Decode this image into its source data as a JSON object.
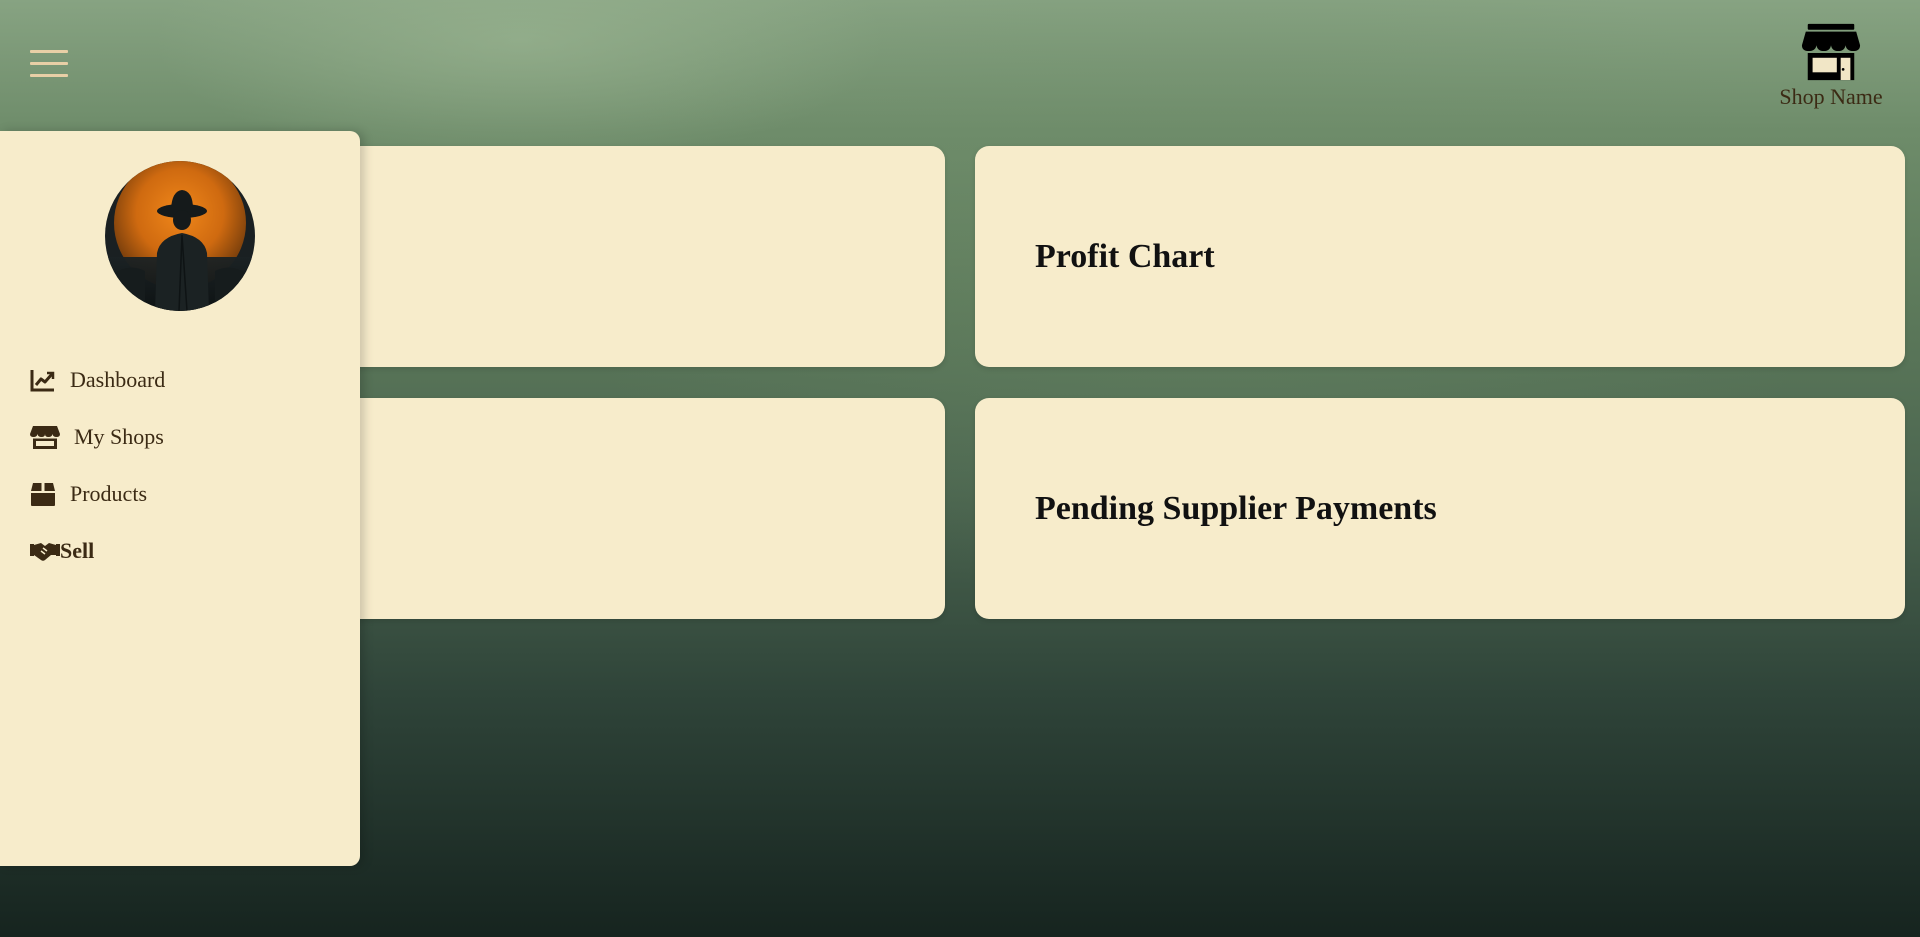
{
  "header": {
    "menu_icon": "hamburger-menu-icon",
    "shop_icon": "store-icon",
    "shop_name": "Shop Name"
  },
  "sidebar": {
    "avatar_icon": "user-avatar",
    "items": [
      {
        "label": "Dashboard",
        "icon": "chart-line-icon"
      },
      {
        "label": "My Shops",
        "icon": "store-icon"
      },
      {
        "label": "Products",
        "icon": "box-icon"
      },
      {
        "label": "Sell",
        "icon": "handshake-icon"
      }
    ]
  },
  "cards": {
    "top_left": {
      "title": ""
    },
    "bottom_left": {
      "title": ""
    },
    "top_right": {
      "title": "Profit Chart"
    },
    "bottom_right": {
      "title": "Pending Supplier Payments"
    }
  },
  "colors": {
    "panel": "#f7eccb",
    "text_dark": "#3b2a14",
    "menu_icon": "#e8cfa6",
    "background_top": "#87a382",
    "background_bottom": "#16241f"
  }
}
